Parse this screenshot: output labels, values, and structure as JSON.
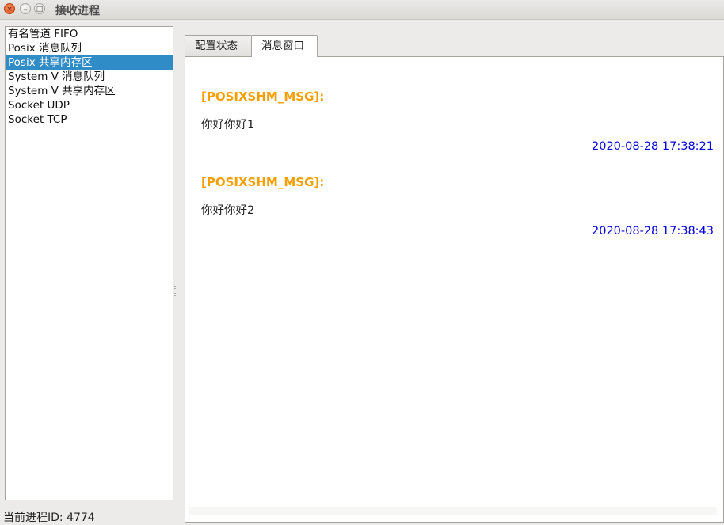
{
  "window": {
    "title": "接收进程",
    "buttons": {
      "close": "×",
      "minimize": "–",
      "maximize": "□"
    }
  },
  "sidebar": {
    "items": [
      {
        "label": "有名管道 FIFO",
        "selected": false
      },
      {
        "label": "Posix 消息队列",
        "selected": false
      },
      {
        "label": "Posix 共享内存区",
        "selected": true
      },
      {
        "label": "System V 消息队列",
        "selected": false
      },
      {
        "label": "System V 共享内存区",
        "selected": false
      },
      {
        "label": "Socket UDP",
        "selected": false
      },
      {
        "label": "Socket TCP",
        "selected": false
      }
    ]
  },
  "tabs": [
    {
      "label": "配置状态",
      "active": false
    },
    {
      "label": "消息窗口",
      "active": true
    }
  ],
  "messages": [
    {
      "tag": "[POSIXSHM_MSG]:",
      "body": "你好你好1",
      "time": "2020-08-28 17:38:21"
    },
    {
      "tag": "[POSIXSHM_MSG]:",
      "body": "你好你好2",
      "time": "2020-08-28 17:38:43"
    }
  ],
  "status": {
    "text": "当前进程ID: 4774"
  },
  "colors": {
    "selection": "#308cc6",
    "message_tag": "#f5a000",
    "timestamp": "#0000e0",
    "close_button": "#e2511e"
  }
}
